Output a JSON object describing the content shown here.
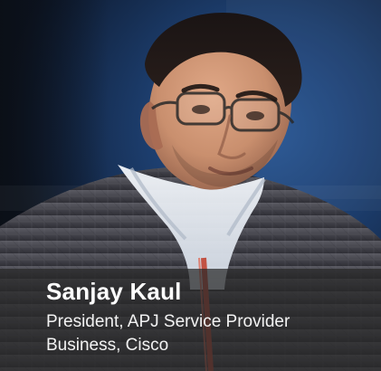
{
  "profile": {
    "name": "Sanjay Kaul",
    "title": "President, APJ Service Provider Business, Cisco"
  },
  "colors": {
    "background_blue": "#1f3a63",
    "suit_gray": "#4a4a52",
    "shirt_white": "#e9edf2",
    "skin_tone": "#c98f6e",
    "caption_overlay": "rgba(40,40,40,0.72)"
  }
}
